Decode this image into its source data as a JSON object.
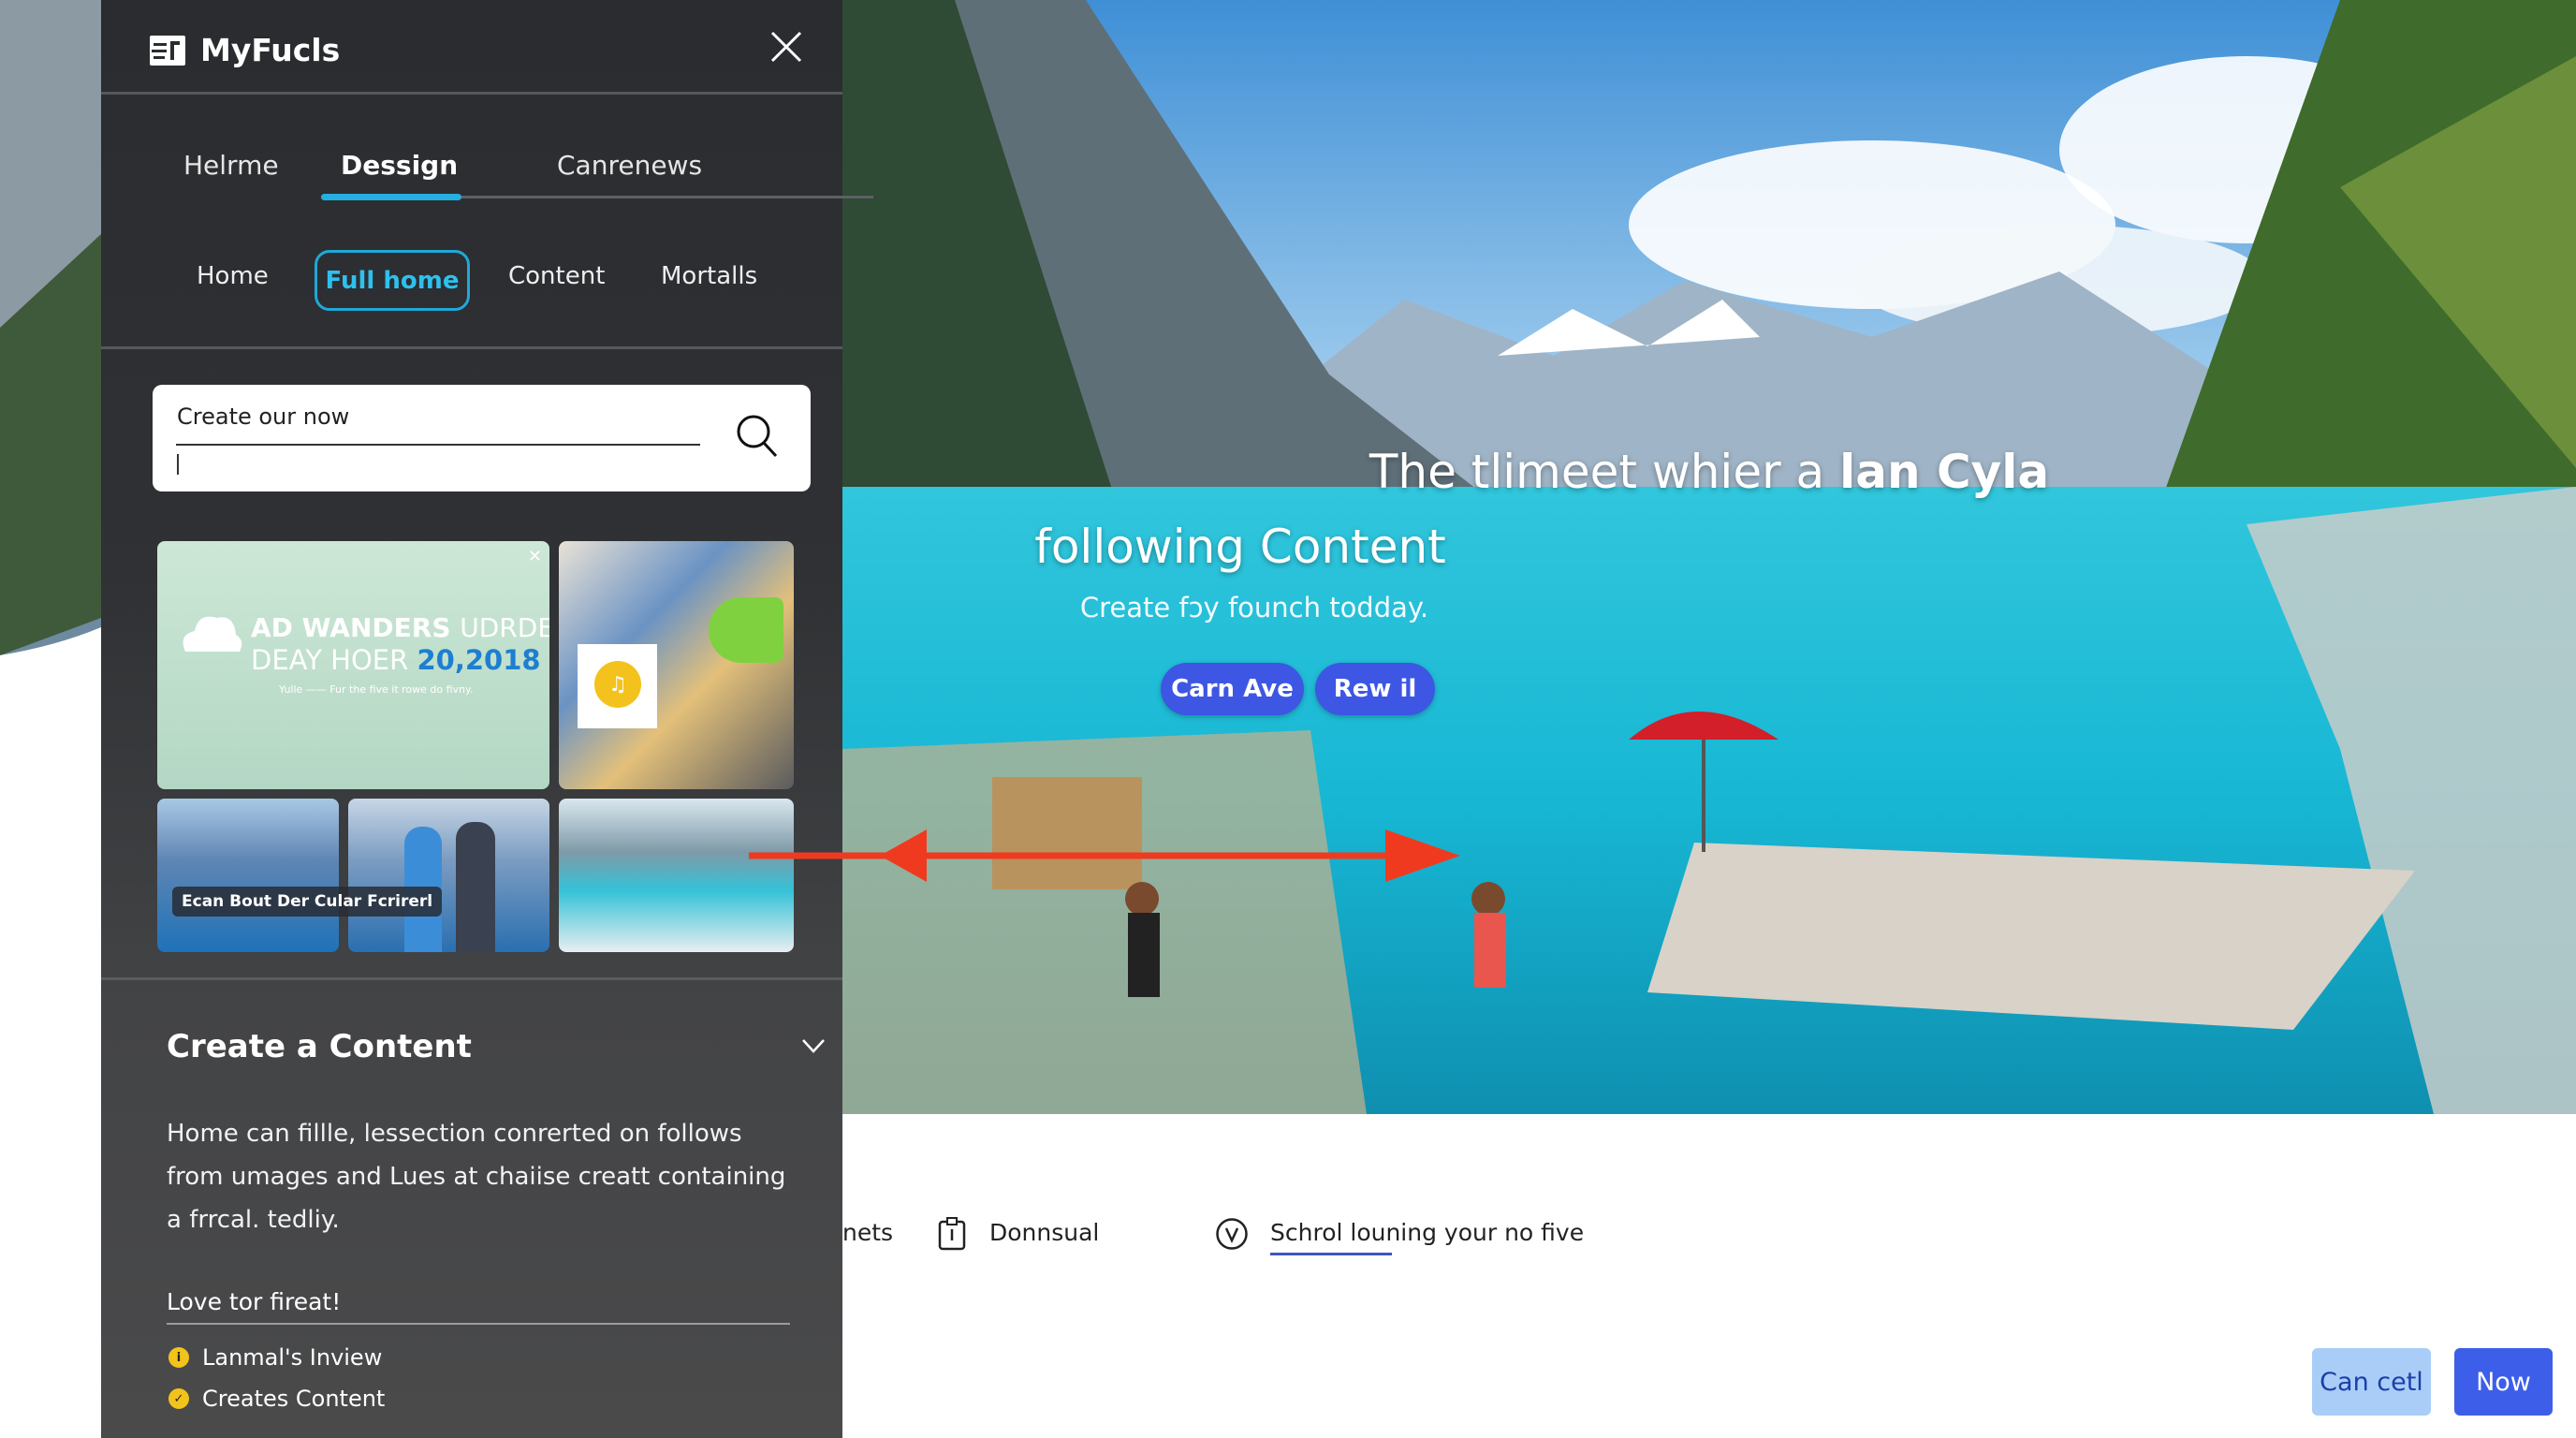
{
  "panel": {
    "app_title": "MyFucls",
    "tabs": [
      {
        "label": "Helrme"
      },
      {
        "label": "Dessign",
        "active": true
      },
      {
        "label": "Canrenews"
      }
    ],
    "subtabs": [
      {
        "label": "Home"
      },
      {
        "label": "Full home",
        "active": true
      },
      {
        "label": "Content"
      },
      {
        "label": "Mortalls"
      }
    ],
    "search": {
      "value": "Create our now",
      "placeholder": ""
    },
    "thumbs": {
      "ad_line1a": "AD WANDERS",
      "ad_line1b": "UDRDE",
      "ad_line2a": "DEAY HOER",
      "ad_line2b": "20,2018",
      "ad_tagline": "Yulle —— Fur the five it rowe do fivny.",
      "caption": "Ecan Bout Der Cular Fcrirerl"
    },
    "section_title": "Create a Content",
    "paragraph": "Home can fillle, lessection conrerted on follows from umages and Lues at chaiise creatt containing a frrcal. tedliy.",
    "list_heading": "Love tor fireat!",
    "list": [
      {
        "label": "Lanmal's Inview",
        "icon": "info-icon"
      },
      {
        "label": "Creates Content",
        "icon": "check-icon"
      }
    ]
  },
  "hero": {
    "title_regular": "The tlimeet whier a",
    "title_bold": "lan Cyla",
    "title_line2": "following Content",
    "subtitle": "Create fɔy founch todday.",
    "buttons": [
      "Carn Ave",
      "Rew il"
    ]
  },
  "bottom": {
    "partial": "nets",
    "item1": "Donnsual",
    "item2": "Schrol louning your no five",
    "cancel": "Can cetl",
    "now": "Now"
  },
  "colors": {
    "accent": "#25aee0",
    "primary": "#3d56e4",
    "cancel_bg": "#a9cdf7",
    "arrow": "#f03a1f"
  }
}
